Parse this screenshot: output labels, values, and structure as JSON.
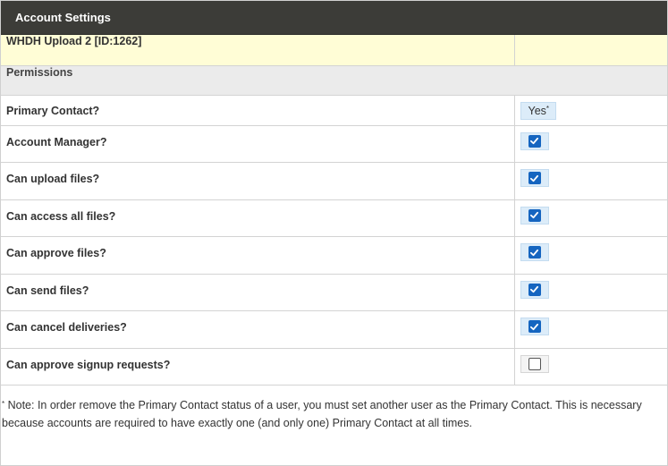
{
  "panel": {
    "title": "Account Settings"
  },
  "account": {
    "name": "WHDH Upload 2 [ID:1262]"
  },
  "section": {
    "title": "Permissions"
  },
  "primary_contact": {
    "label": "Primary Contact?",
    "value": "Yes",
    "marker": "*"
  },
  "permissions": [
    {
      "label": "Account Manager?",
      "checked": true
    },
    {
      "label": "Can upload files?",
      "checked": true
    },
    {
      "label": "Can access all files?",
      "checked": true
    },
    {
      "label": "Can approve files?",
      "checked": true
    },
    {
      "label": "Can send files?",
      "checked": true
    },
    {
      "label": "Can cancel deliveries?",
      "checked": true
    },
    {
      "label": "Can approve signup requests?",
      "checked": false
    }
  ],
  "note": {
    "marker": "*",
    "text": " Note: In order remove the Primary Contact status of a user, you must set another user as the Primary Contact. This is necessary because accounts are required to have exactly one (and only one) Primary Contact at all times."
  },
  "colors": {
    "header_bg": "#3c3c38",
    "account_row_bg": "#fffdd6",
    "section_bg": "#ebebeb",
    "checkbox_blue": "#1565c0"
  }
}
